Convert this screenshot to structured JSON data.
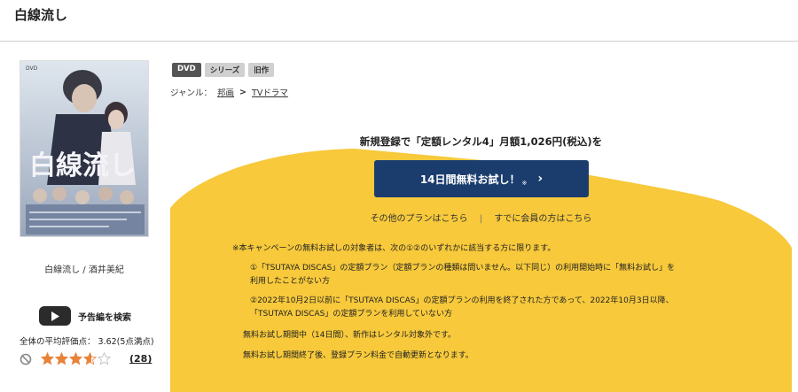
{
  "page": {
    "title": "白線流し"
  },
  "product": {
    "cover_title": "白線流し",
    "caption": "白線流し / 酒井美紀",
    "trailer_label": "予告編を検索",
    "rating_text": "全体の平均評価点： 3.62(5点満点)",
    "rating_value": 3.62,
    "rating_max": 5,
    "review_count": "(28)"
  },
  "tags": [
    "DVD",
    "シリーズ",
    "旧作"
  ],
  "genre": {
    "label": "ジャンル：",
    "path": [
      "邦画",
      "TVドラマ"
    ],
    "separator": ">"
  },
  "promo": {
    "heading": "新規登録で「定額レンタル4」月額1,026円(税込)を",
    "cta_label": "14日間無料お試し！",
    "cta_note": "※",
    "cta_chevron": "›",
    "other_plans": "その他のプランはこちら",
    "divider": "|",
    "member_link": "すでに会員の方はこちら",
    "terms": [
      "※本キャンペーンの無料お試しの対象者は、次の①②のいずれかに該当する方に限ります。",
      "①「TSUTAYA DISCAS」の定額プラン（定額プランの種類は問いません。以下同じ）の利用開始時に「無料お試し」を",
      "利用したことがない方",
      "②2022年10月2日以前に「TSUTAYA DISCAS」の定額プランの利用を終了された方であって、2022年10月3日以降、",
      "「TSUTAYA DISCAS」の定額プランを利用していない方",
      "無料お試し期間中（14日間）、新作はレンタル対象外です。",
      "無料お試し期間終了後、登録プラン料金で自動更新となります。"
    ]
  },
  "colors": {
    "accent_yellow": "#f7c93b",
    "cta_navy": "#1a3d6e",
    "star_orange": "#e8833a"
  }
}
